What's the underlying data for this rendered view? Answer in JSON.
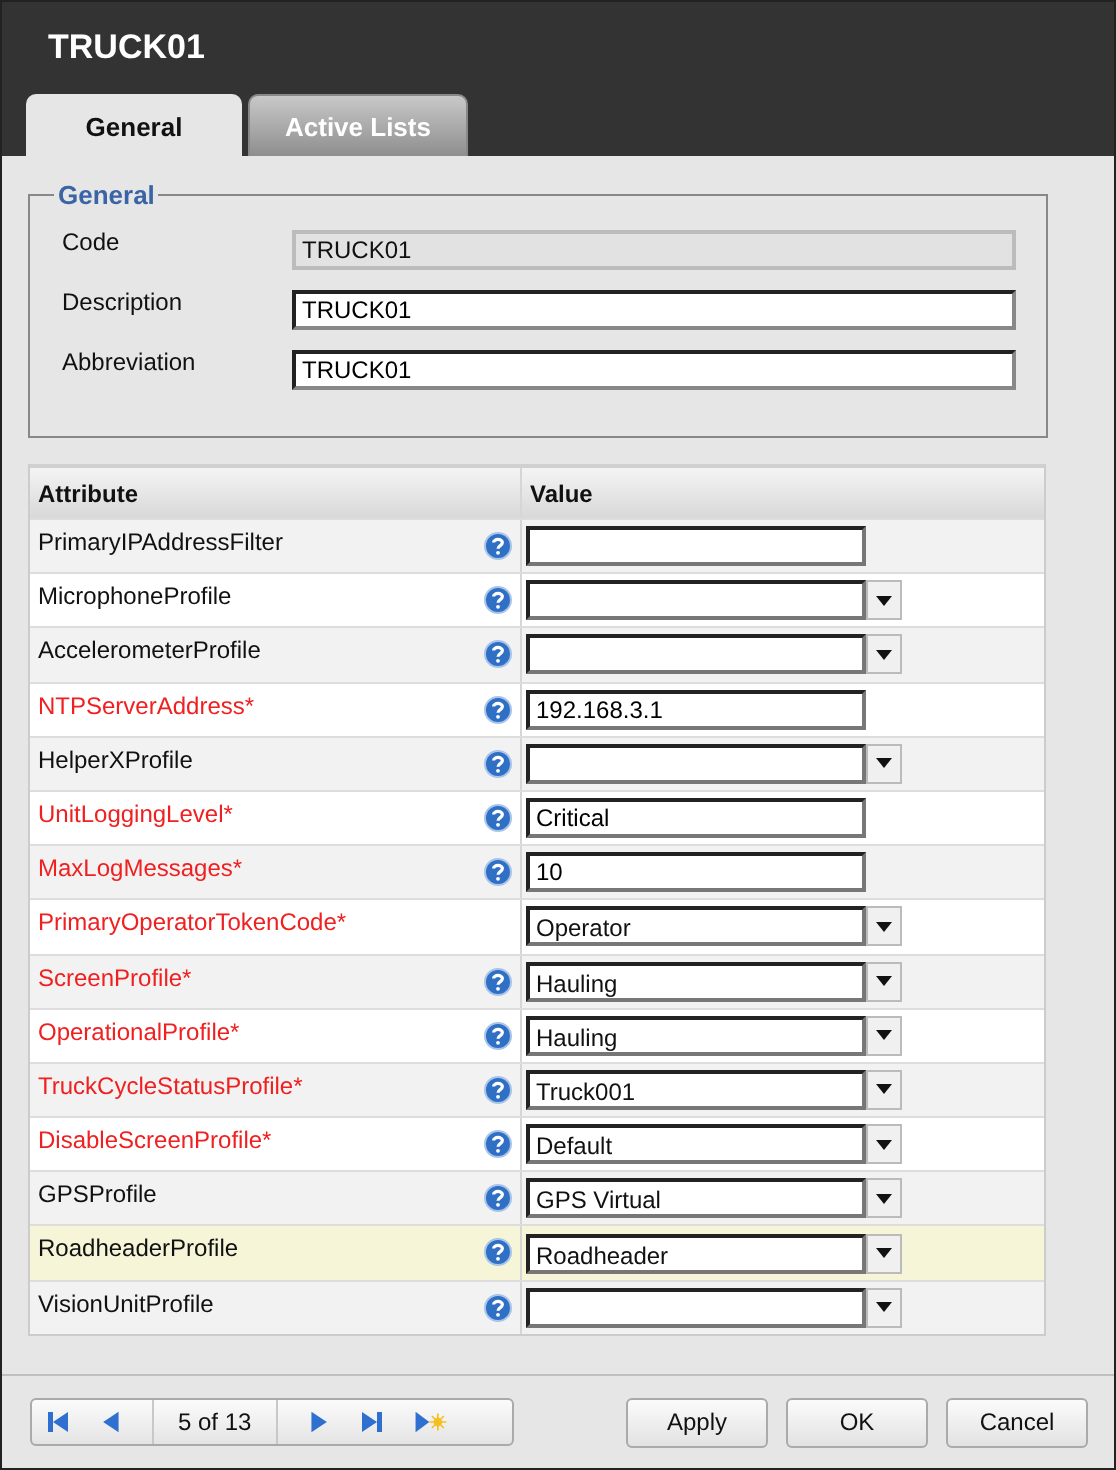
{
  "window": {
    "title": "TRUCK01"
  },
  "tabs": [
    {
      "label": "General",
      "selected": true
    },
    {
      "label": "Active Lists",
      "selected": false
    }
  ],
  "general": {
    "legend": "General",
    "fields": [
      {
        "label": "Code",
        "value": "TRUCK01",
        "disabled": true
      },
      {
        "label": "Description",
        "value": "TRUCK01",
        "disabled": false
      },
      {
        "label": "Abbreviation",
        "value": "TRUCK01",
        "disabled": false
      }
    ]
  },
  "table": {
    "columns": [
      "Attribute",
      "Value"
    ],
    "rows": [
      {
        "attribute": "PrimaryIPAddressFilter",
        "required": false,
        "help": true,
        "kind": "text",
        "value": "",
        "selected": false
      },
      {
        "attribute": "MicrophoneProfile",
        "required": false,
        "help": true,
        "kind": "select",
        "value": "",
        "selected": false
      },
      {
        "attribute": "AccelerometerProfile",
        "required": false,
        "help": true,
        "kind": "select",
        "value": "",
        "selected": false
      },
      {
        "attribute": "NTPServerAddress*",
        "required": true,
        "help": true,
        "kind": "text",
        "value": "192.168.3.1",
        "selected": false
      },
      {
        "attribute": "HelperXProfile",
        "required": false,
        "help": true,
        "kind": "select",
        "value": "",
        "selected": false
      },
      {
        "attribute": "UnitLoggingLevel*",
        "required": true,
        "help": true,
        "kind": "text",
        "value": "Critical",
        "selected": false
      },
      {
        "attribute": "MaxLogMessages*",
        "required": true,
        "help": true,
        "kind": "text",
        "value": "10",
        "selected": false
      },
      {
        "attribute": "PrimaryOperatorTokenCode*",
        "required": true,
        "help": false,
        "kind": "select",
        "value": "Operator",
        "selected": false
      },
      {
        "attribute": "ScreenProfile*",
        "required": true,
        "help": true,
        "kind": "select",
        "value": "Hauling",
        "selected": false
      },
      {
        "attribute": "OperationalProfile*",
        "required": true,
        "help": true,
        "kind": "select",
        "value": "Hauling",
        "selected": false
      },
      {
        "attribute": "TruckCycleStatusProfile*",
        "required": true,
        "help": true,
        "kind": "select",
        "value": "Truck001",
        "selected": false
      },
      {
        "attribute": "DisableScreenProfile*",
        "required": true,
        "help": true,
        "kind": "select",
        "value": "Default",
        "selected": false
      },
      {
        "attribute": "GPSProfile",
        "required": false,
        "help": true,
        "kind": "select",
        "value": "GPS Virtual",
        "selected": false
      },
      {
        "attribute": "RoadheaderProfile",
        "required": false,
        "help": true,
        "kind": "select",
        "value": "Roadheader",
        "selected": true
      },
      {
        "attribute": "VisionUnitProfile",
        "required": false,
        "help": true,
        "kind": "select",
        "value": "",
        "selected": false
      }
    ]
  },
  "pager": {
    "position": "5 of 13"
  },
  "buttons": [
    "Apply",
    "OK",
    "Cancel"
  ]
}
